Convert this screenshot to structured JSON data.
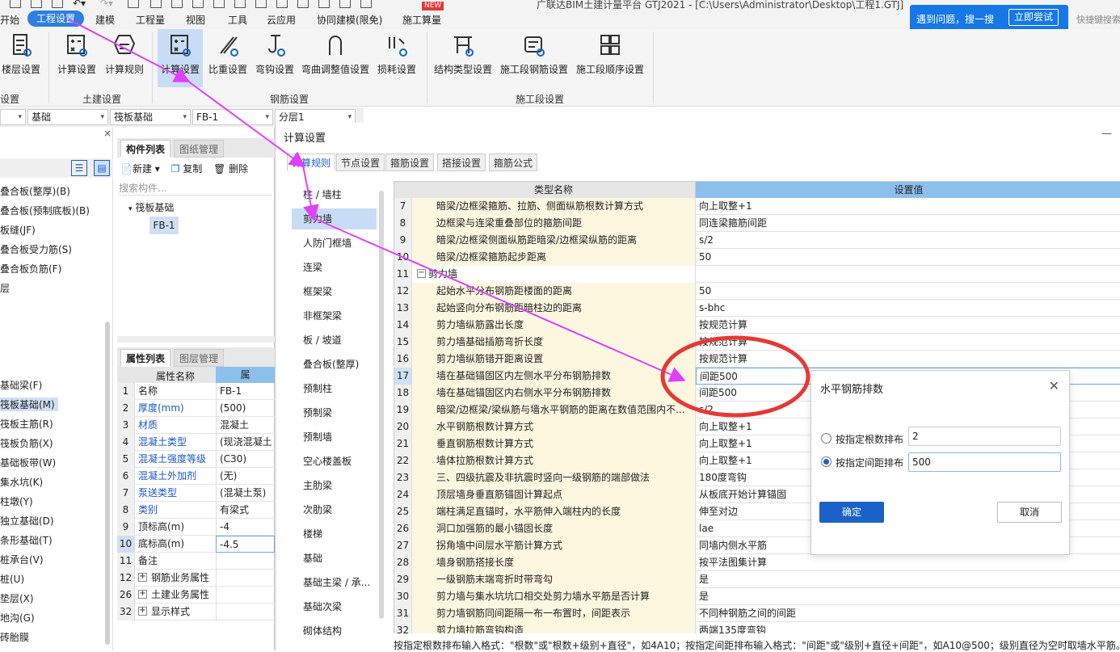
{
  "menu": {
    "items": [
      "开始",
      "工程设置",
      "建模",
      "工程量",
      "视图",
      "工具",
      "云应用",
      "协同建模(限免)",
      "施工算量"
    ],
    "active": "工程设置",
    "new_badge": "NEW"
  },
  "window_title": "广联达BIM土建计量平台 GTJ2021 - [C:\\Users\\Administrator\\Desktop\\工程1.GTJ]",
  "help": {
    "text": "遇到问题，搜一搜",
    "button": "立即尝试",
    "shortcut": "快捷键搜索"
  },
  "ribbon": {
    "buttons": [
      "楼层设置",
      "计算设置",
      "计算规则",
      "计算设置",
      "比重设置",
      "弯钩设置",
      "弯曲调整值设置",
      "损耗设置",
      "结构类型设置",
      "施工段钢筋设置",
      "施工段顺序设置"
    ],
    "groups": [
      "设置",
      "土建设置",
      "钢筋设置",
      "施工段设置"
    ]
  },
  "selectors": [
    "基础",
    "筏板基础",
    "FB-1",
    "分层1"
  ],
  "left_panel": {
    "items": [
      "叠合板(整厚)(B)",
      "叠合板(预制底板)(B)",
      "板缝(JF)",
      "叠合板受力筋(S)",
      "叠合板负筋(F)",
      "层",
      "基础梁(F)",
      "筏板基础(M)",
      "筏板主筋(R)",
      "筏板负筋(X)",
      "基础板带(W)",
      "集水坑(K)",
      "柱墩(Y)",
      "独立基础(D)",
      "条形基础(T)",
      "桩承台(V)",
      "桩(U)",
      "垫层(X)",
      "地沟(G)",
      "砖胎膜"
    ],
    "selected": "筏板基础(M)"
  },
  "component_panel": {
    "tabs": [
      "构件列表",
      "图纸管理"
    ],
    "new": "新建",
    "copy": "复制",
    "delete": "删除",
    "search_placeholder": "搜索构件...",
    "tree_root": "筏板基础",
    "tree_child": "FB-1"
  },
  "property_panel": {
    "tabs": [
      "属性列表",
      "图层管理"
    ],
    "header_name": "属性名称",
    "header_val": "属",
    "rows": [
      {
        "n": "1",
        "name": "名称",
        "val": "FB-1"
      },
      {
        "n": "2",
        "name": "厚度(mm)",
        "val": "(500)"
      },
      {
        "n": "3",
        "name": "材质",
        "val": "混凝土"
      },
      {
        "n": "4",
        "name": "混凝土类型",
        "val": "(现浇混凝土"
      },
      {
        "n": "5",
        "name": "混凝土强度等级",
        "val": "(C30)"
      },
      {
        "n": "6",
        "name": "混凝土外加剂",
        "val": "(无)"
      },
      {
        "n": "7",
        "name": "泵送类型",
        "val": "(混凝土泵)"
      },
      {
        "n": "8",
        "name": "类别",
        "val": "有梁式"
      },
      {
        "n": "9",
        "name": "顶标高(m)",
        "val": "-4"
      },
      {
        "n": "10",
        "name": "底标高(m)",
        "val": "-4.5"
      },
      {
        "n": "11",
        "name": "备注",
        "val": ""
      },
      {
        "n": "12",
        "name": "钢筋业务属性",
        "val": ""
      },
      {
        "n": "26",
        "name": "土建业务属性",
        "val": ""
      },
      {
        "n": "32",
        "name": "显示样式",
        "val": ""
      }
    ]
  },
  "dialog": {
    "title": "计算设置",
    "tabs": [
      "计算规则",
      "节点设置",
      "箍筋设置",
      "搭接设置",
      "箍筋公式"
    ],
    "categories": [
      "柱 / 墙柱",
      "剪力墙",
      "人防门框墙",
      "连梁",
      "框架梁",
      "非框架梁",
      "板 / 坡道",
      "叠合板(整厚)",
      "预制柱",
      "预制梁",
      "预制墙",
      "空心楼盖板",
      "主肋梁",
      "次肋梁",
      "楼梯",
      "基础",
      "基础主梁 / 承...",
      "基础次梁",
      "砌体结构"
    ],
    "active_category": "剪力墙",
    "grid_header_name": "类型名称",
    "grid_header_val": "设置值",
    "rows": [
      {
        "n": "7",
        "name": "暗梁/边框梁箍筋、拉筋、侧面纵筋根数计算方式",
        "val": "向上取整+1"
      },
      {
        "n": "8",
        "name": "边框梁与连梁重叠部位的箍筋间距",
        "val": "同连梁箍筋间距"
      },
      {
        "n": "9",
        "name": "暗梁/边框梁侧面纵筋距暗梁/边框梁纵筋的距离",
        "val": "s/2"
      },
      {
        "n": "10",
        "name": "暗梁/边框梁箍筋起步距离",
        "val": "50"
      },
      {
        "n": "11",
        "name": "剪力墙",
        "val": "",
        "section": true
      },
      {
        "n": "12",
        "name": "起始水平分布钢筋距楼面的距离",
        "val": "50"
      },
      {
        "n": "13",
        "name": "起始竖向分布钢筋距暗柱边的距离",
        "val": "s-bhc"
      },
      {
        "n": "14",
        "name": "剪力墙纵筋露出长度",
        "val": "按规范计算"
      },
      {
        "n": "15",
        "name": "剪力墙基础插筋弯折长度",
        "val": "按规范计算"
      },
      {
        "n": "16",
        "name": "剪力墙纵筋错开距离设置",
        "val": "按规范计算"
      },
      {
        "n": "17",
        "name": "墙在基础锚固区内左侧水平分布钢筋排数",
        "val": "间距500",
        "hl": true
      },
      {
        "n": "18",
        "name": "墙在基础锚固区内右侧水平分布钢筋排数",
        "val": "间距500"
      },
      {
        "n": "19",
        "name": "暗梁/边框梁/梁纵筋与墙水平钢筋的距离在数值范围内不...",
        "val": "s/2"
      },
      {
        "n": "20",
        "name": "水平钢筋根数计算方式",
        "val": "向上取整+1"
      },
      {
        "n": "21",
        "name": "垂直钢筋根数计算方式",
        "val": "向上取整+1"
      },
      {
        "n": "22",
        "name": "墙体拉筋根数计算方式",
        "val": "向上取整+1"
      },
      {
        "n": "23",
        "name": "三、四级抗震及非抗震时竖向一级钢筋的端部做法",
        "val": "180度弯钩"
      },
      {
        "n": "24",
        "name": "顶层墙身垂直筋锚固计算起点",
        "val": "从板底开始计算锚固"
      },
      {
        "n": "25",
        "name": "端柱满足直锚时，水平筋伸入端柱内的长度",
        "val": "伸至对边"
      },
      {
        "n": "26",
        "name": "洞口加强筋的最小锚固长度",
        "val": "lae"
      },
      {
        "n": "27",
        "name": "拐角墙中间层水平筋计算方式",
        "val": "同墙内侧水平筋"
      },
      {
        "n": "28",
        "name": "墙身钢筋搭接长度",
        "val": "按平法图集计算"
      },
      {
        "n": "29",
        "name": "一级钢筋末端弯折时带弯勾",
        "val": "是"
      },
      {
        "n": "30",
        "name": "剪力墙与集水坑坑口相交处剪力墙水平筋是否计算",
        "val": "是"
      },
      {
        "n": "31",
        "name": "剪力墙钢筋同间距隔一布一布置时，间距表示",
        "val": "不同种钢筋之间的间距"
      },
      {
        "n": "32",
        "name": "剪力墙拉筋弯钩构造",
        "val": "两端135度弯钩"
      }
    ],
    "hint": "按指定根数排布输入格式：\"根数\"或\"根数+级别+直径\"，如4A10；按指定间距排布输入格式：\"间距\"或\"级别+直径+间距\"，如A10@500；级别直径为空时取墙水平筋。未"
  },
  "popup": {
    "title": "水平钢筋排数",
    "option1": "按指定根数排布",
    "value1": "2",
    "option2": "按指定间距排布",
    "value2": "500",
    "ok": "确定",
    "cancel": "取消"
  },
  "colors": {
    "accent": "#2f7fe0",
    "annotation_arrow": "#e040fb",
    "annotation_circle": "#e53935"
  }
}
